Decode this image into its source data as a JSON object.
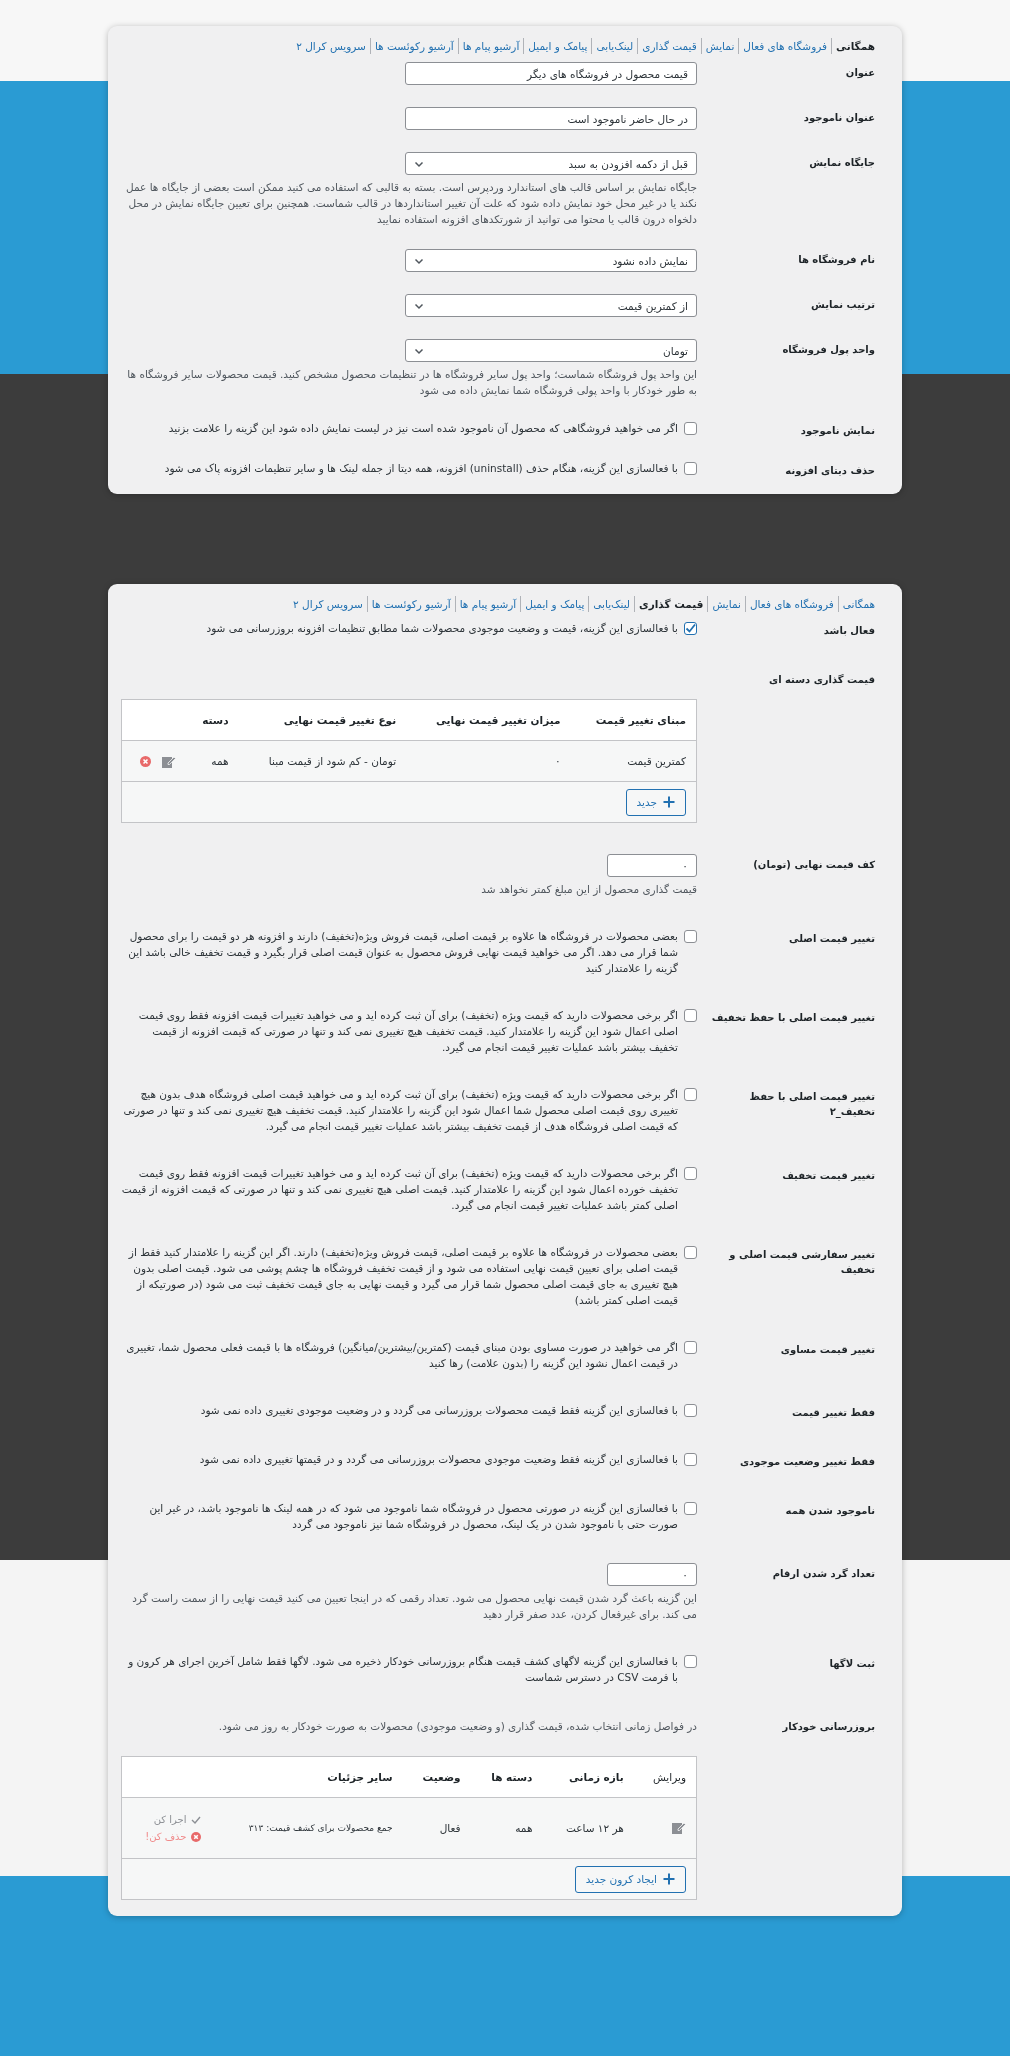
{
  "cards": [
    {
      "tabs": [
        {
          "label": "همگانی",
          "selected": true
        },
        {
          "label": "فروشگاه های فعال",
          "selected": false
        },
        {
          "label": "نمایش",
          "selected": false
        },
        {
          "label": "قیمت گذاری",
          "selected": false
        },
        {
          "label": "لینک‌یابی",
          "selected": false
        },
        {
          "label": "پیامک و ایمیل",
          "selected": false
        },
        {
          "label": "آرشیو پیام ها",
          "selected": false
        },
        {
          "label": "آرشیو رکوئست ها",
          "selected": false
        },
        {
          "label": "سرویس کرال ۲",
          "selected": false
        }
      ],
      "fields": [
        {
          "kind": "text",
          "label": "عنوان",
          "value": "قیمت محصول در فروشگاه های دیگر"
        },
        {
          "kind": "text",
          "label": "عنوان ناموجود",
          "value": "در حال حاضر ناموجود است"
        },
        {
          "kind": "select",
          "label": "جایگاه نمایش",
          "value": "قبل از دکمه افزودن به سبد",
          "description": "جایگاه نمایش بر اساس قالب های استاندارد وردپرس است. بسته به قالبی که استفاده می کنید ممکن است بعضی از جایگاه ها عمل نکند یا در غیر محل خود نمایش داده شود که علت آن تغییر استانداردها در قالب شماست. همچنین برای تعیین جایگاه نمایش در محل دلخواه درون قالب یا محتوا می توانید از شورتکدهای افزونه استفاده نمایید"
        },
        {
          "kind": "select",
          "label": "نام فروشگاه ها",
          "value": "نمایش داده نشود"
        },
        {
          "kind": "select",
          "label": "ترتیب نمایش",
          "value": "از کمترین قیمت"
        },
        {
          "kind": "select",
          "label": "واحد پول فروشگاه",
          "value": "تومان",
          "description": "این واحد پول فروشگاه شماست؛ واحد پول سایر فروشگاه ها در تنظیمات محصول مشخص کنید. قیمت محصولات سایر فروشگاه ها به طور خودکار با واحد پولی فروشگاه شما نمایش داده می شود"
        },
        {
          "kind": "checkbox",
          "label": "نمایش ناموجود",
          "text": "اگر می خواهید فروشگاهی که محصول آن ناموجود شده است نیز در لیست نمایش داده شود این گزینه را علامت بزنید",
          "checked": false
        },
        {
          "kind": "checkbox",
          "label": "حذف دیتای افزونه",
          "text": "با فعالسازی این گزینه، هنگام حذف (uninstall) افزونه، همه دیتا از جمله لینک ها و سایر تنظیمات افزونه پاک می شود",
          "checked": false
        }
      ]
    },
    {
      "tabs": [
        {
          "label": "همگانی",
          "selected": false
        },
        {
          "label": "فروشگاه های فعال",
          "selected": false
        },
        {
          "label": "نمایش",
          "selected": false
        },
        {
          "label": "قیمت گذاری",
          "selected": true
        },
        {
          "label": "لینک‌یابی",
          "selected": false
        },
        {
          "label": "پیامک و ایمیل",
          "selected": false
        },
        {
          "label": "آرشیو پیام ها",
          "selected": false
        },
        {
          "label": "آرشیو رکوئست ها",
          "selected": false
        },
        {
          "label": "سرویس کرال ۲",
          "selected": false
        }
      ],
      "fields": [
        {
          "kind": "checkbox",
          "label": "فعال باشد",
          "text": "با فعالسازی این گزینه، قیمت و وضعیت موجودی محصولات شما مطابق تنظیمات افزونه بروزرسانی می شود",
          "checked": true
        },
        {
          "kind": "rules_table",
          "label": "قیمت گذاری دسته ای",
          "columns": [
            "مبنای تغییر قیمت",
            "میزان تغییر قیمت نهایی",
            "نوع تغییر قیمت نهایی",
            "دسته"
          ],
          "rows": [
            {
              "cells": [
                "کمترین قیمت",
                "۰",
                "تومان - کم شود از قیمت مبنا",
                "همه"
              ]
            }
          ],
          "button": "جدید"
        },
        {
          "kind": "number",
          "label": "کف قیمت نهایی (تومان)",
          "value": "۰",
          "description": "قیمت گذاری محصول از این مبلغ کمتر نخواهد شد"
        },
        {
          "kind": "checkbox",
          "label": "تغییر قیمت اصلی",
          "text": "بعضی محصولات در فروشگاه ها علاوه بر قیمت اصلی، قیمت فروش ویژه(تخفیف) دارند و افزونه هر دو قیمت را برای محصول شما قرار می دهد. اگر می خواهید قیمت نهایی فروش محصول به عنوان قیمت اصلی قرار بگیرد و قیمت تخفیف خالی باشد این گزینه را علامتدار کنید",
          "checked": false
        },
        {
          "kind": "checkbox",
          "label": "تغییر قیمت اصلی با حفظ تخفیف",
          "text": "اگر برخی محصولات دارید که قیمت ویژه (تخفیف) برای آن ثبت کرده اید و می خواهید تغییرات قیمت افزونه فقط روی قیمت اصلی اعمال شود این گزینه را علامتدار کنید. قیمت تخفیف هیچ تغییری نمی کند و تنها در صورتی که قیمت افزونه از قیمت تخفیف بیشتر باشد عملیات تغییر قیمت انجام می گیرد.",
          "checked": false
        },
        {
          "kind": "checkbox",
          "label": "تغییر قیمت اصلی با حفظ تخفیف_۲",
          "text": "اگر برخی محصولات دارید که قیمت ویژه (تخفیف) برای آن ثبت کرده اید و می خواهید قیمت اصلی فروشگاه هدف بدون هیچ تغییری روی قیمت اصلی محصول شما اعمال شود این گزینه را علامتدار کنید. قیمت تخفیف هیچ تغییری نمی کند و تنها در صورتی که قیمت اصلی فروشگاه هدف از قیمت تخفیف بیشتر باشد عملیات تغییر قیمت انجام می گیرد.",
          "checked": false
        },
        {
          "kind": "checkbox",
          "label": "تغییر قیمت تخفیف",
          "text": "اگر برخی محصولات دارید که قیمت ویژه (تخفیف) برای آن ثبت کرده اید و می خواهید تغییرات قیمت افزونه فقط روی قیمت تخفیف خورده اعمال شود این گزینه را علامتدار کنید. قیمت اصلی هیچ تغییری نمی کند و تنها در صورتی که قیمت افزونه از قیمت اصلی کمتر باشد عملیات تغییر قیمت انجام می گیرد.",
          "checked": false
        },
        {
          "kind": "checkbox",
          "label": "تغییر سفارشی قیمت اصلی و تخفیف",
          "text": "بعضی محصولات در فروشگاه ها علاوه بر قیمت اصلی، قیمت فروش ویژه(تخفیف) دارند. اگر این گزینه را علامتدار کنید فقط از قیمت اصلی برای تعیین قیمت نهایی استفاده می شود و از قیمت تخفیف فروشگاه ها چشم پوشی می شود. قیمت اصلی بدون هیچ تغییری به جای قیمت اصلی محصول شما قرار می گیرد و قیمت نهایی به جای قیمت تخفیف ثبت می شود (در صورتیکه از قیمت اصلی کمتر باشد)",
          "checked": false
        },
        {
          "kind": "checkbox",
          "label": "تغییر قیمت مساوی",
          "text": "اگر می خواهید در صورت مساوی بودن مبنای قیمت (کمترین/بیشترین/میانگین) فروشگاه ها با قیمت فعلی محصول شما، تغییری در قیمت اعمال نشود این گزینه را (بدون علامت) رها کنید",
          "checked": false
        },
        {
          "kind": "checkbox",
          "label": "فقط تغییر قیمت",
          "text": "با فعالسازی این گزینه فقط قیمت محصولات بروزرسانی می گردد و در وضعیت موجودی تغییری داده نمی شود",
          "checked": false
        },
        {
          "kind": "checkbox",
          "label": "فقط تغییر وضعیت موجودی",
          "text": "با فعالسازی این گزینه فقط وضعیت موجودی محصولات بروزرسانی می گردد و در قیمتها تغییری داده نمی شود",
          "checked": false
        },
        {
          "kind": "checkbox",
          "label": "ناموجود شدن همه",
          "text": "با فعالسازی این گزینه در صورتی محصول در فروشگاه شما ناموجود می شود که در همه لینک ها ناموجود باشد، در غیر این صورت حتی با ناموجود شدن در یک لینک، محصول در فروشگاه شما نیز ناموجود می گردد",
          "checked": false
        },
        {
          "kind": "number",
          "label": "تعداد گرد شدن ارقام",
          "value": "۰",
          "description": "این گزینه باعث گرد شدن قیمت نهایی محصول می شود. تعداد رقمی که در اینجا تعیین می کنید قیمت نهایی را از سمت راست گرد می کند. برای غیرفعال کردن، عدد صفر قرار دهید"
        },
        {
          "kind": "checkbox",
          "label": "ثبت لاگها",
          "text": "با فعالسازی این گزینه لاگهای کشف قیمت هنگام بروزرسانی خودکار ذخیره می شود. لاگها فقط شامل آخرین اجرای هر کرون و با فرمت CSV در دسترس شماست",
          "checked": false
        },
        {
          "kind": "cron_table",
          "label": "بروزرسانی خودکار",
          "description": "در فواصل زمانی انتخاب شده، قیمت گذاری (و وضعیت موجودی) محصولات به صورت خودکار به روز می شود.",
          "columns": [
            "ویرایش",
            "بازه زمانی",
            "دسته ها",
            "وضعیت",
            "سایر جزئیات"
          ],
          "rows": [
            {
              "cells": [
                "",
                "هر ۱۲ ساعت",
                "همه",
                "فعال",
                "جمع محصولات برای کشف قیمت: ۳۱۳"
              ],
              "actions": [
                {
                  "kind": "run",
                  "label": "اجرا کن"
                },
                {
                  "kind": "delete",
                  "label": "حذف کن!"
                }
              ]
            }
          ],
          "button": "ایجاد کرون جدید"
        }
      ]
    }
  ]
}
